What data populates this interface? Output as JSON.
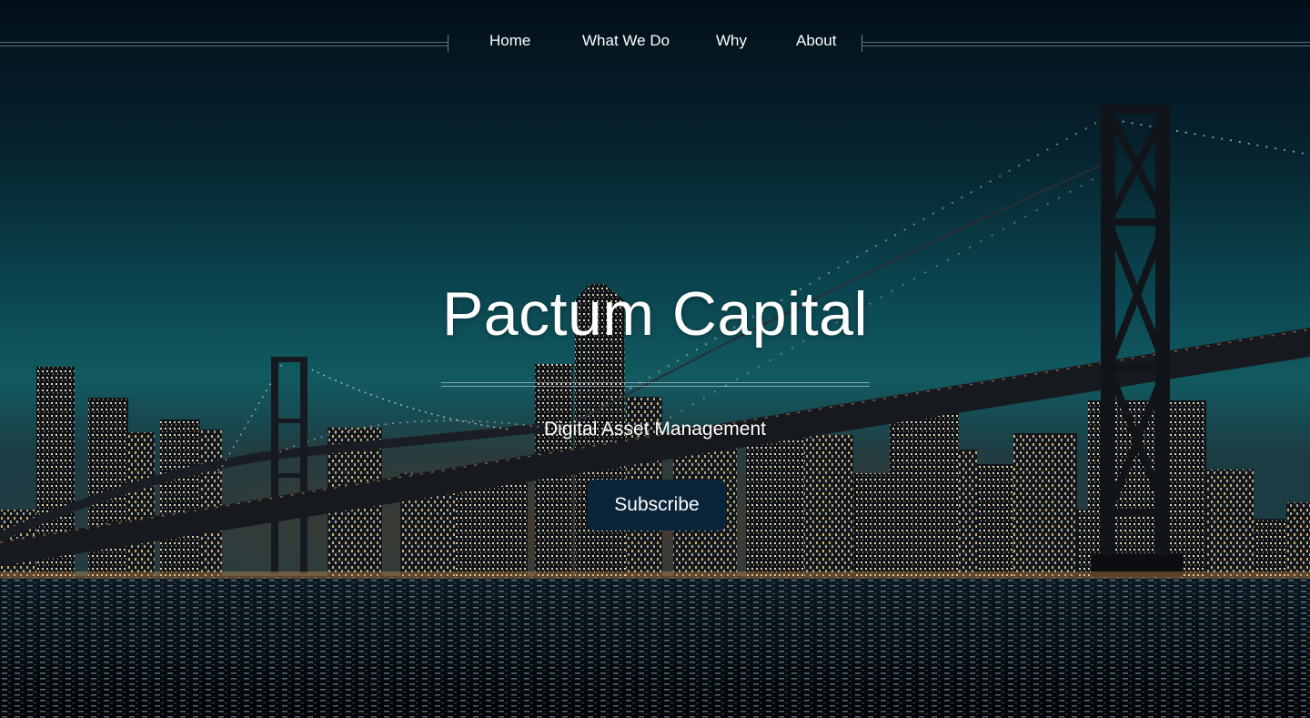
{
  "nav": {
    "items": [
      {
        "label": "Home"
      },
      {
        "label": "What We Do"
      },
      {
        "label": "Why"
      },
      {
        "label": "About"
      }
    ]
  },
  "hero": {
    "title": "Pactum Capital",
    "subtitle": "Digital Asset Management",
    "cta_label": "Subscribe",
    "background": "night-city-skyline-bridge-photo"
  },
  "colors": {
    "sky_top": "#041018",
    "sky_mid": "#0d4a52",
    "water": "#02080d",
    "button": "#0a2439",
    "text": "#ffffff"
  }
}
